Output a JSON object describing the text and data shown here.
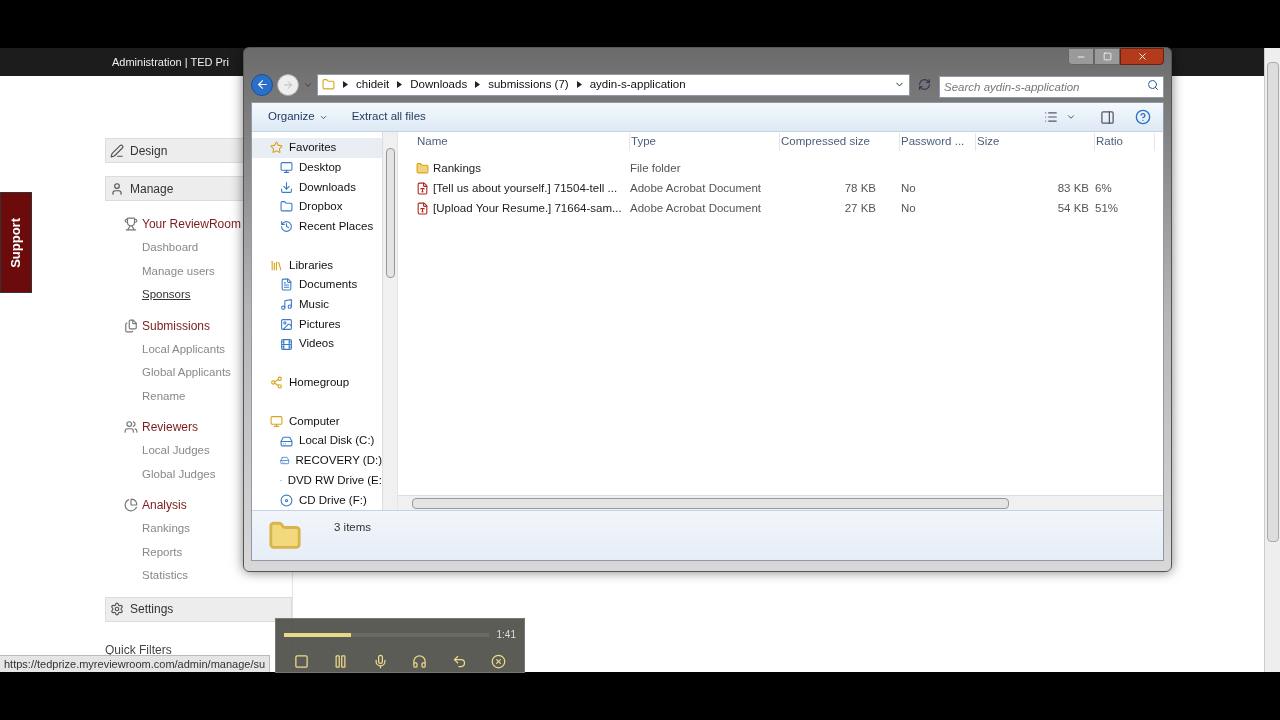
{
  "page": {
    "header_title": "Administration | TED Pri",
    "support_tab": "Support",
    "menu": [
      {
        "kind": "header",
        "label": "Design"
      },
      {
        "kind": "header",
        "label": "Manage"
      },
      {
        "kind": "group",
        "label": "Your ReviewRoom",
        "items": [
          {
            "label": "Dashboard",
            "hovered": false
          },
          {
            "label": "Manage users",
            "hovered": false
          },
          {
            "label": "Sponsors",
            "hovered": true
          }
        ]
      },
      {
        "kind": "group",
        "label": "Submissions",
        "items": [
          {
            "label": "Local Applicants",
            "hovered": false
          },
          {
            "label": "Global Applicants",
            "hovered": false
          },
          {
            "label": "Rename",
            "hovered": false
          }
        ]
      },
      {
        "kind": "group",
        "label": "Reviewers",
        "items": [
          {
            "label": "Local Judges",
            "hovered": false
          },
          {
            "label": "Global Judges",
            "hovered": false
          }
        ]
      },
      {
        "kind": "group",
        "label": "Analysis",
        "items": [
          {
            "label": "Rankings",
            "hovered": false
          },
          {
            "label": "Reports",
            "hovered": false
          },
          {
            "label": "Statistics",
            "hovered": false
          }
        ]
      },
      {
        "kind": "header",
        "label": "Settings"
      }
    ],
    "quick_filters": "Quick Filters",
    "status_url": "https://tedprize.myreviewroom.com/admin/manage/su"
  },
  "explorer": {
    "breadcrumb": [
      "chideit",
      "Downloads",
      "submissions (7)",
      "aydin-s-application"
    ],
    "search": {
      "placeholder": "Search aydin-s-application"
    },
    "toolbar": [
      "Organize",
      "Extract all files"
    ],
    "nav": [
      {
        "label": "Favorites",
        "selected": true,
        "children": [
          {
            "label": "Desktop",
            "selected": false
          },
          {
            "label": "Downloads",
            "selected": false
          },
          {
            "label": "Dropbox",
            "selected": false
          },
          {
            "label": "Recent Places",
            "selected": false
          }
        ]
      },
      {
        "label": "Libraries",
        "selected": false,
        "children": [
          {
            "label": "Documents",
            "selected": false
          },
          {
            "label": "Music",
            "selected": false
          },
          {
            "label": "Pictures",
            "selected": false
          },
          {
            "label": "Videos",
            "selected": false
          }
        ]
      },
      {
        "label": "Homegroup",
        "selected": false
      },
      {
        "label": "Computer",
        "selected": false,
        "children": [
          {
            "label": "Local Disk (C:)",
            "selected": false
          },
          {
            "label": "RECOVERY (D:)",
            "selected": false
          },
          {
            "label": "DVD RW Drive (E:",
            "selected": false
          },
          {
            "label": "CD Drive (F:)",
            "selected": false
          }
        ]
      }
    ],
    "columns": [
      "Name",
      "Type",
      "Compressed size",
      "Password ...",
      "Size",
      "Ratio"
    ],
    "rows": [
      {
        "kind": "folder",
        "name": "Rankings",
        "type": "File folder",
        "compressed": "",
        "password": "",
        "size": "",
        "ratio": ""
      },
      {
        "kind": "pdf",
        "name": "[Tell us about yourself.] 71504-tell ...",
        "type": "Adobe Acrobat Document",
        "compressed": "78 KB",
        "password": "No",
        "size": "83 KB",
        "ratio": "6%"
      },
      {
        "kind": "pdf",
        "name": "[Upload Your Resume.] 71664-sam...",
        "type": "Adobe Acrobat Document",
        "compressed": "27 KB",
        "password": "No",
        "size": "54 KB",
        "ratio": "51%"
      }
    ],
    "status": "3 items"
  },
  "recorder": {
    "level": 0.33,
    "time": "1:41"
  }
}
